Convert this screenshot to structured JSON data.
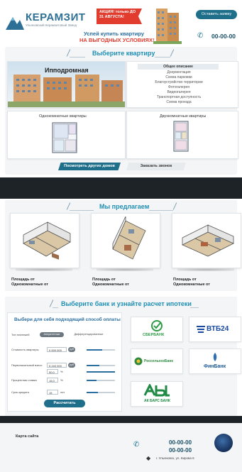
{
  "header": {
    "logo_text": "КЕРАМЗИТ",
    "logo_sub": "Ульяновский Керамзитовый Завод",
    "promo_badge": "АКЦИЯ! только ДО 31 АВГУСТА!",
    "promo_line1": "Успей купить квартиру",
    "promo_line2": "НА ВЫГОДНЫХ УСЛОВИЯХ!",
    "callback_label": "Оставить заявку",
    "phone": "00-00-00"
  },
  "choose": {
    "title": "Выберите квартиру",
    "hero_title": "Ипподромная",
    "desc_head": "Общее описание",
    "desc_items": [
      "Документация",
      "Схема парковки",
      "Благоустройство территории",
      "Фотогалерея",
      "Видеогалерея",
      "Транспортная доступность",
      "Схема проезда"
    ],
    "plan1_title": "Однокомнатные квартиры",
    "plan2_title": "Двухкомнатные квартиры",
    "btn_other": "Посмотреть других домов",
    "btn_call": "Заказать звонок"
  },
  "offer": {
    "title": "Мы предлагаем",
    "cards": [
      {
        "line1": "Площадь от",
        "line2": "Однокомнатные от"
      },
      {
        "line1": "Площадь от",
        "line2": "Однокомнатные от"
      },
      {
        "line1": "Площадь от",
        "line2": "Однокомнатные от"
      }
    ]
  },
  "mortgage": {
    "title": "Выберите банк и узнайте расчет ипотеки",
    "calc_title": "Выбери для себя подходящий способ оплаты",
    "type_label": "Тип платежей",
    "type_options": [
      "Аннуитетные",
      "Дифференцированные"
    ],
    "rows": [
      {
        "label": "Стоимость квартиры",
        "value": "0 000 000",
        "unit": "руб"
      },
      {
        "label": "Первоначальный взнос",
        "value": "5 240 000",
        "unit": "руб"
      },
      {
        "label": "",
        "value": "50,0",
        "unit": "%"
      },
      {
        "label": "Процентная ставка",
        "value": "15,0",
        "unit": "%"
      },
      {
        "label": "Срок кредита",
        "value": "15",
        "unit": "лет"
      }
    ],
    "calc_button": "Рассчитать",
    "banks": [
      "СБЕРБАНК",
      "ВТБ24",
      "РоссельхозБанк",
      "ФинБанк",
      "АК БАРС БАНК"
    ]
  },
  "footer": {
    "sitemap": "Карта сайта",
    "phone1": "00-00-00",
    "phone2": "00-00-00",
    "address": "г. Ульяновск, ул. Кирова 6"
  },
  "colors": {
    "accent": "#1f6f8b",
    "title_blue": "#1f8fb4",
    "promo_red": "#e23c2f",
    "dark_band": "#1e2327"
  }
}
